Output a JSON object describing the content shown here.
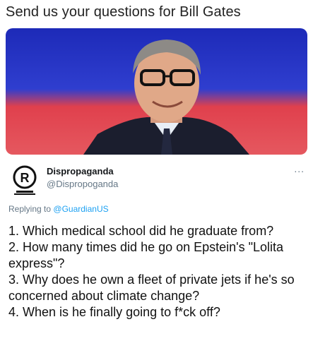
{
  "headline": "Send us your questions for Bill Gates",
  "photo": {
    "description_icon": "portrait-photo",
    "colors": {
      "sky": "#2f3ecf",
      "band": "#e0404d"
    }
  },
  "tweet": {
    "display_name": "Dispropaganda",
    "handle": "@Dispropoganda",
    "avatar_letter": "R",
    "more_icon": "ellipsis-icon",
    "more_label": "...",
    "reply_prefix": "Replying to",
    "reply_mention": "@GuardianUS",
    "questions": [
      "1. Which medical school did he graduate from?",
      "2. How many times did he go on Epstein's \"Lolita express\"?",
      "3. Why does he own a fleet of private jets if he's so concerned about climate change?",
      "4. When is he finally going to f*ck off?"
    ]
  }
}
